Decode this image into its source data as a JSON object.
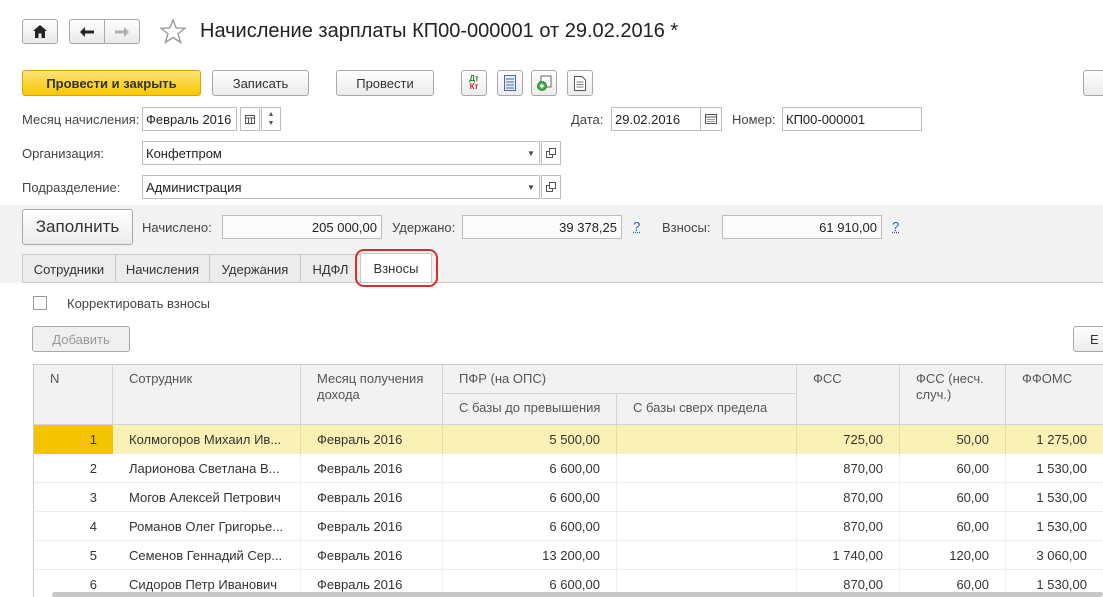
{
  "window": {
    "title": "Начисление зарплаты КП00-000001 от 29.02.2016 *"
  },
  "toolbar": {
    "post_close_label": "Провести и закрыть",
    "save_label": "Записать",
    "post_label": "Провести",
    "dtkt_icon_text": "ДтКт",
    "right_edge_button": ""
  },
  "form": {
    "month_label": "Месяц начисления:",
    "month_value": "Февраль 2016",
    "date_label": "Дата:",
    "date_value": "29.02.2016",
    "number_label": "Номер:",
    "number_value": "КП00-000001",
    "org_label": "Организация:",
    "org_value": "Конфетпром",
    "dept_label": "Подразделение:",
    "dept_value": "Администрация"
  },
  "totals": {
    "fill_label": "Заполнить",
    "accrued_label": "Начислено:",
    "accrued_value": "205 000,00",
    "withheld_label": "Удержано:",
    "withheld_value": "39 378,25",
    "contrib_label": "Взносы:",
    "contrib_value": "61 910,00",
    "help": "?"
  },
  "tabs": [
    {
      "label": "Сотрудники"
    },
    {
      "label": "Начисления"
    },
    {
      "label": "Удержания"
    },
    {
      "label": "НДФЛ"
    },
    {
      "label": "Взносы"
    }
  ],
  "contrib_tab": {
    "adjust_label": "Корректировать взносы",
    "add_label": "Добавить",
    "right_button_label": "Е"
  },
  "table": {
    "headers": {
      "n": "N",
      "employee": "Сотрудник",
      "income_month": "Месяц получения дохода",
      "pfr": "ПФР (на ОПС)",
      "pfr_base": "С базы до превышения",
      "pfr_over": "С базы сверх предела",
      "fss": "ФСС",
      "fss_accident": "ФСС (несч. случ.)",
      "ffoms": "ФФОМС"
    },
    "rows": [
      {
        "n": "1",
        "employee": "Колмогоров Михаил Ив...",
        "month": "Февраль 2016",
        "pfr_base": "5 500,00",
        "pfr_over": "",
        "fss": "725,00",
        "fss_acc": "50,00",
        "ffoms": "1 275,00"
      },
      {
        "n": "2",
        "employee": "Ларионова Светлана В...",
        "month": "Февраль 2016",
        "pfr_base": "6 600,00",
        "pfr_over": "",
        "fss": "870,00",
        "fss_acc": "60,00",
        "ffoms": "1 530,00"
      },
      {
        "n": "3",
        "employee": "Могов Алексей Петрович",
        "month": "Февраль 2016",
        "pfr_base": "6 600,00",
        "pfr_over": "",
        "fss": "870,00",
        "fss_acc": "60,00",
        "ffoms": "1 530,00"
      },
      {
        "n": "4",
        "employee": "Романов Олег Григорье...",
        "month": "Февраль 2016",
        "pfr_base": "6 600,00",
        "pfr_over": "",
        "fss": "870,00",
        "fss_acc": "60,00",
        "ffoms": "1 530,00"
      },
      {
        "n": "5",
        "employee": "Семенов Геннадий Сер...",
        "month": "Февраль 2016",
        "pfr_base": "13 200,00",
        "pfr_over": "",
        "fss": "1 740,00",
        "fss_acc": "120,00",
        "ffoms": "3 060,00"
      },
      {
        "n": "6",
        "employee": "Сидоров Петр Иванович",
        "month": "Февраль 2016",
        "pfr_base": "6 600,00",
        "pfr_over": "",
        "fss": "870,00",
        "fss_acc": "60,00",
        "ffoms": "1 530,00"
      }
    ]
  },
  "colors": {
    "primary_button": "#f6c700",
    "selected_row": "#faf1b4",
    "highlight_ring": "#d03030",
    "help_link": "#2a63b0"
  }
}
